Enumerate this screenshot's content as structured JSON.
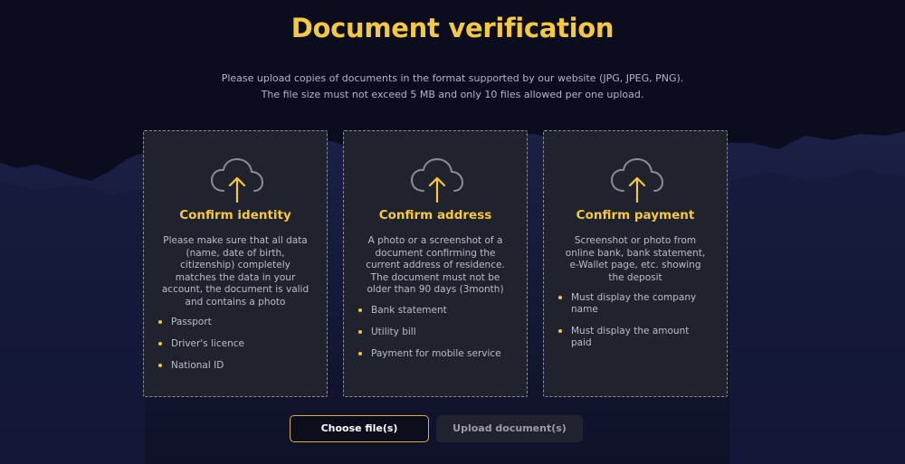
{
  "page": {
    "title": "Document verification",
    "intro": [
      "Please upload copies of documents in the format supported by our website (JPG, JPEG, PNG).",
      "The file size must not exceed 5 MB and only 10 files allowed per one upload."
    ]
  },
  "cards": [
    {
      "title": "Confirm identity",
      "icon": "cloud-upload-icon",
      "description": [
        "Please make sure that all data",
        "(name, date of birth,",
        "citizenship) completely",
        "matches the data in your",
        "account, the document is valid",
        "and contains a photo"
      ],
      "bullets": [
        [
          "Passport"
        ],
        [
          "Driver's licence"
        ],
        [
          "National ID"
        ]
      ]
    },
    {
      "title": "Confirm address",
      "icon": "cloud-upload-icon",
      "description": [
        "A photo or a screenshot of a",
        "document confirming the",
        "current address of residence.",
        "The document must not be",
        "older than 90 days (3month)"
      ],
      "bullets": [
        [
          "Bank statement"
        ],
        [
          "Utility bill"
        ],
        [
          "Payment for mobile service"
        ]
      ]
    },
    {
      "title": "Confirm payment",
      "icon": "cloud-upload-icon",
      "description": [
        "Screenshot or photo from",
        "online bank, bank statement,",
        "e-Wallet page, etc. showing",
        "the deposit"
      ],
      "bullets": [
        [
          "Must display the company",
          "name"
        ],
        [
          "Must display the amount",
          "paid"
        ]
      ]
    }
  ],
  "buttons": {
    "choose": "Choose file(s)",
    "upload": "Upload document(s)"
  },
  "colors": {
    "accent": "#f5c842",
    "background": "#0b0d1e",
    "card": "#20232d",
    "text": "#b9bccb"
  }
}
